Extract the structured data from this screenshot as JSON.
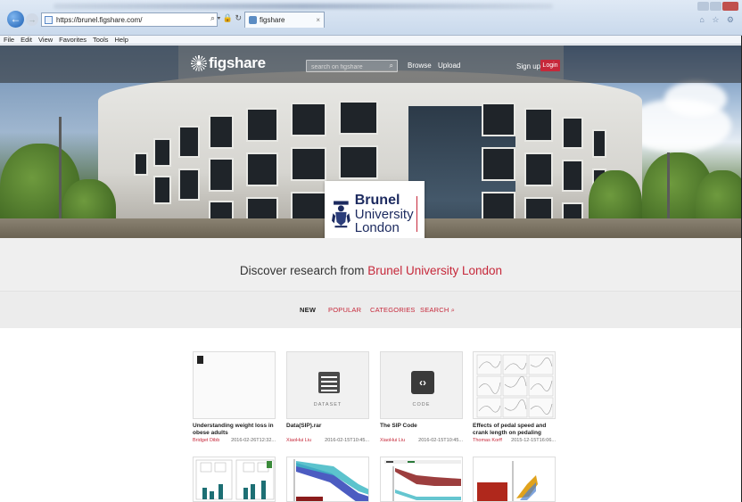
{
  "browser": {
    "url": "https://brunel.figshare.com/",
    "tab_title": "figshare",
    "tab_close": "×",
    "back_glyph": "←",
    "forward_glyph": "→",
    "address_tools": "⌕ ▾ 🔒 ↻ ✕",
    "menu": [
      "File",
      "Edit",
      "View",
      "Favorites",
      "Tools",
      "Help"
    ],
    "corner_icons": "⌂ ☆ ⚙"
  },
  "header": {
    "logo_text": "figshare",
    "search_placeholder": "search on figshare",
    "browse": "Browse",
    "upload": "Upload",
    "signup": "Sign up",
    "login": "Login"
  },
  "institution_logo": {
    "line1": "Brunel",
    "line2": "University",
    "line3": "London"
  },
  "discover": {
    "prefix": "Discover research from",
    "institution": "Brunel University London"
  },
  "tabs": [
    "NEW",
    "POPULAR",
    "CATEGORIES",
    "SEARCH"
  ],
  "items": [
    {
      "title": "Understanding weight loss in obese adults",
      "author": "Bridget Dibb",
      "date": "2016-02-26T12:32...",
      "type": "paper"
    },
    {
      "title": "Data(SIP).rar",
      "author": "XiaoHui Liu",
      "date": "2016-02-15T10:45...",
      "type": "dataset",
      "label": "DATASET"
    },
    {
      "title": "The SIP Code",
      "author": "XiaoHui Liu",
      "date": "2016-02-15T10:45...",
      "type": "code",
      "label": "CODE"
    },
    {
      "title": "Effects of pedal speed and crank length on pedaling mechanics in",
      "author": "Thomas Korff",
      "date": "2015-12-15T16:06...",
      "type": "figure"
    }
  ],
  "colors": {
    "accent": "#c6283a",
    "brunel_navy": "#1c2a5f",
    "band": "#efefef"
  }
}
